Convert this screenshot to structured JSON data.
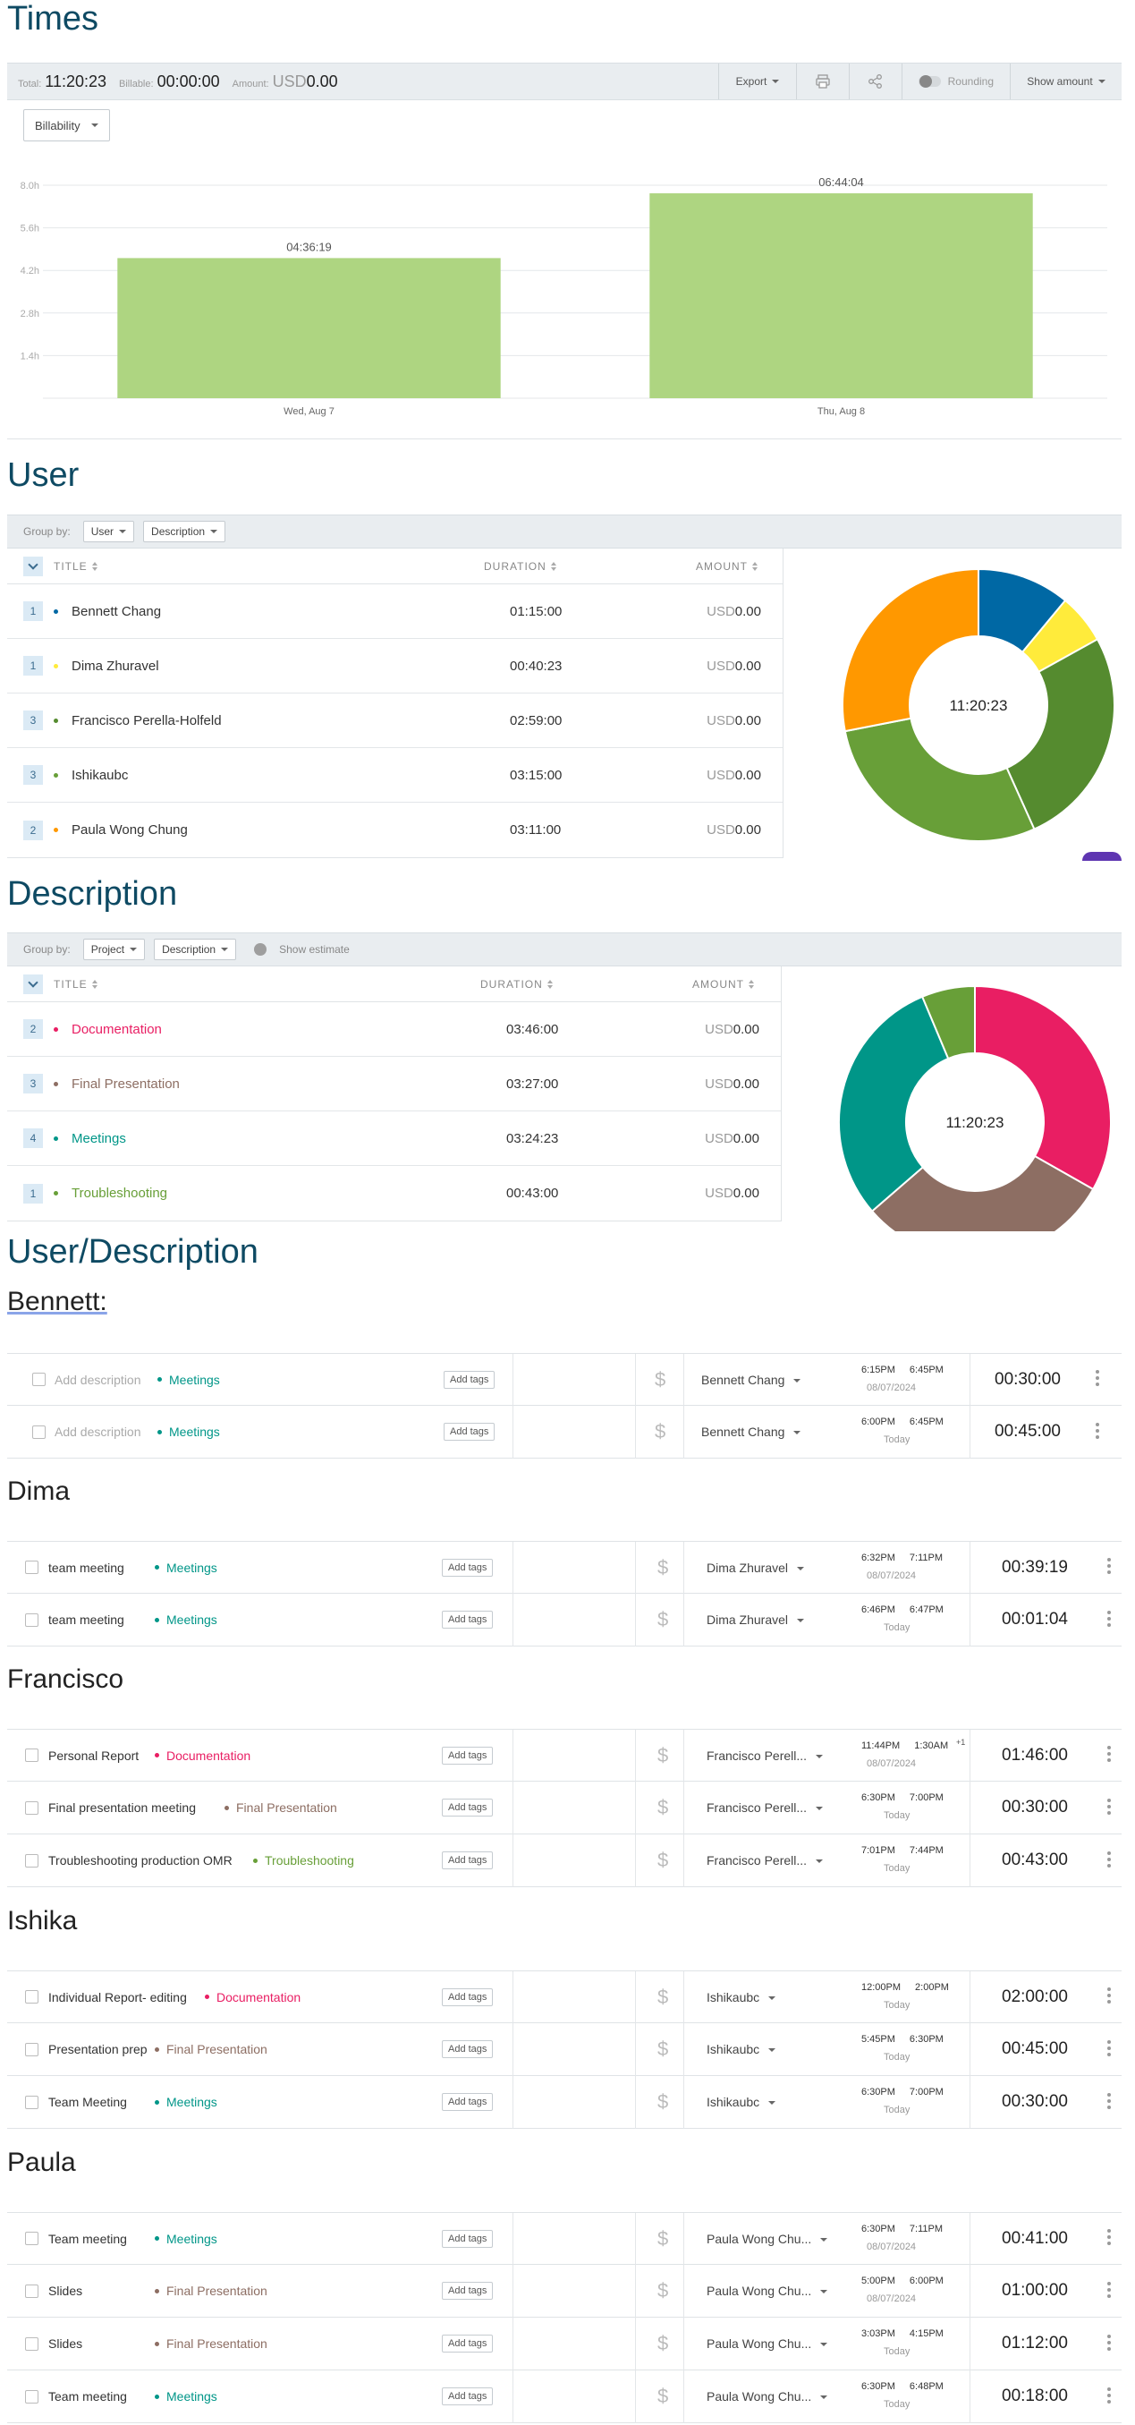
{
  "times": {
    "title": "Times",
    "summary": {
      "total_label": "Total:",
      "total_value": "11:20:23",
      "billable_label": "Billable:",
      "billable_value": "00:00:00",
      "amount_label": "Amount:",
      "amount_currency": "USD",
      "amount_value": "0.00"
    },
    "toolbar": {
      "export": "Export",
      "rounding": "Rounding",
      "show_amount": "Show amount"
    },
    "billability": "Billability"
  },
  "chart_data": {
    "type": "bar",
    "categories": [
      "Wed, Aug 7",
      "Thu, Aug 8"
    ],
    "values": [
      4.6053,
      6.7344
    ],
    "value_labels": [
      "04:36:19",
      "06:44:04"
    ],
    "yticks": [
      "1.4h",
      "2.8h",
      "4.2h",
      "5.6h",
      "8.0h"
    ],
    "ytick_values": [
      1.4,
      2.8,
      4.2,
      5.6,
      7.0
    ],
    "ylim": [
      0,
      7.5
    ],
    "color": "#aed581",
    "grid": true
  },
  "user": {
    "title": "User",
    "group_by": "Group by:",
    "groups": [
      "User",
      "Description"
    ],
    "headers": {
      "title": "TITLE",
      "duration": "DURATION",
      "amount": "AMOUNT"
    },
    "rows": [
      {
        "count": "1",
        "name": "Bennett Chang",
        "duration": "01:15:00",
        "currency": "USD",
        "amount": "0.00",
        "color": "#0068a4",
        "hours": 1.25
      },
      {
        "count": "1",
        "name": "Dima Zhuravel",
        "duration": "00:40:23",
        "currency": "USD",
        "amount": "0.00",
        "color": "#ffeb3b",
        "hours": 0.673
      },
      {
        "count": "3",
        "name": "Francisco Perella-Holfeld",
        "duration": "02:59:00",
        "currency": "USD",
        "amount": "0.00",
        "color": "#558b2f",
        "hours": 2.983
      },
      {
        "count": "3",
        "name": "Ishikaubc",
        "duration": "03:15:00",
        "currency": "USD",
        "amount": "0.00",
        "color": "#689f38",
        "hours": 3.25
      },
      {
        "count": "2",
        "name": "Paula Wong Chung",
        "duration": "03:11:00",
        "currency": "USD",
        "amount": "0.00",
        "color": "#ff9800",
        "hours": 3.183
      }
    ],
    "total": "11:20:23"
  },
  "description": {
    "title": "Description",
    "group_by": "Group by:",
    "groups": [
      "Project",
      "Description"
    ],
    "show_estimate": "Show estimate",
    "headers": {
      "title": "TITLE",
      "duration": "DURATION",
      "amount": "AMOUNT"
    },
    "rows": [
      {
        "count": "2",
        "name": "Documentation",
        "duration": "03:46:00",
        "currency": "USD",
        "amount": "0.00",
        "color": "#e91e63",
        "hours": 3.767
      },
      {
        "count": "3",
        "name": "Final Presentation",
        "duration": "03:27:00",
        "currency": "USD",
        "amount": "0.00",
        "color": "#8d6e63",
        "hours": 3.45
      },
      {
        "count": "4",
        "name": "Meetings",
        "duration": "03:24:23",
        "currency": "USD",
        "amount": "0.00",
        "color": "#009688",
        "hours": 3.406
      },
      {
        "count": "1",
        "name": "Troubleshooting",
        "duration": "00:43:00",
        "currency": "USD",
        "amount": "0.00",
        "color": "#689f38",
        "hours": 0.717
      }
    ],
    "total": "11:20:23"
  },
  "user_description": {
    "title": "User/Description",
    "add_tags": "Add tags",
    "groups": [
      {
        "name": "Bennett:",
        "underline": true,
        "entries": [
          {
            "desc": "Add description",
            "placeholder": true,
            "project": "Meetings",
            "pcolor": "#009688",
            "user": "Bennett Chang",
            "start": "6:15PM",
            "end": "6:45PM",
            "date": "08/07/2024",
            "duration": "00:30:00"
          },
          {
            "desc": "Add description",
            "placeholder": true,
            "project": "Meetings",
            "pcolor": "#009688",
            "user": "Bennett Chang",
            "start": "6:00PM",
            "end": "6:45PM",
            "date": "Today",
            "duration": "00:45:00"
          }
        ]
      },
      {
        "name": "Dima",
        "entries": [
          {
            "desc": "team meeting",
            "project": "Meetings",
            "pcolor": "#009688",
            "user": "Dima Zhuravel",
            "start": "6:32PM",
            "end": "7:11PM",
            "date": "08/07/2024",
            "duration": "00:39:19"
          },
          {
            "desc": "team meeting",
            "project": "Meetings",
            "pcolor": "#009688",
            "user": "Dima Zhuravel",
            "start": "6:46PM",
            "end": "6:47PM",
            "date": "Today",
            "duration": "00:01:04"
          }
        ]
      },
      {
        "name": "Francisco",
        "entries": [
          {
            "desc": "Personal Report",
            "project": "Documentation",
            "pcolor": "#e91e63",
            "user": "Francisco Perell...",
            "start": "11:44PM",
            "end": "1:30AM",
            "plus": "+1",
            "date": "08/07/2024",
            "duration": "01:46:00"
          },
          {
            "desc": "Final presentation meeting",
            "project": "Final Presentation",
            "pcolor": "#8d6e63",
            "user": "Francisco Perell...",
            "start": "6:30PM",
            "end": "7:00PM",
            "date": "Today",
            "duration": "00:30:00"
          },
          {
            "desc": "Troubleshooting production OMR",
            "project": "Troubleshooting",
            "pcolor": "#689f38",
            "user": "Francisco Perell...",
            "start": "7:01PM",
            "end": "7:44PM",
            "date": "Today",
            "duration": "00:43:00"
          }
        ]
      },
      {
        "name": "Ishika",
        "entries": [
          {
            "desc": "Individual Report- editing",
            "project": "Documentation",
            "pcolor": "#e91e63",
            "user": "Ishikaubc",
            "start": "12:00PM",
            "end": "2:00PM",
            "date": "Today",
            "duration": "02:00:00"
          },
          {
            "desc": "Presentation prep",
            "project": "Final Presentation",
            "pcolor": "#8d6e63",
            "user": "Ishikaubc",
            "start": "5:45PM",
            "end": "6:30PM",
            "date": "Today",
            "duration": "00:45:00"
          },
          {
            "desc": "Team Meeting",
            "project": "Meetings",
            "pcolor": "#009688",
            "user": "Ishikaubc",
            "start": "6:30PM",
            "end": "7:00PM",
            "date": "Today",
            "duration": "00:30:00"
          }
        ]
      },
      {
        "name": "Paula",
        "entries": [
          {
            "desc": "Team meeting",
            "project": "Meetings",
            "pcolor": "#009688",
            "user": "Paula Wong Chu...",
            "start": "6:30PM",
            "end": "7:11PM",
            "date": "08/07/2024",
            "duration": "00:41:00"
          },
          {
            "desc": "Slides",
            "project": "Final Presentation",
            "pcolor": "#8d6e63",
            "user": "Paula Wong Chu...",
            "start": "5:00PM",
            "end": "6:00PM",
            "date": "08/07/2024",
            "duration": "01:00:00"
          },
          {
            "desc": "Slides",
            "project": "Final Presentation",
            "pcolor": "#8d6e63",
            "user": "Paula Wong Chu...",
            "start": "3:03PM",
            "end": "4:15PM",
            "date": "Today",
            "duration": "01:12:00"
          },
          {
            "desc": "Team meeting",
            "project": "Meetings",
            "pcolor": "#009688",
            "user": "Paula Wong Chu...",
            "start": "6:30PM",
            "end": "6:48PM",
            "date": "Today",
            "duration": "00:18:00"
          }
        ]
      }
    ]
  }
}
